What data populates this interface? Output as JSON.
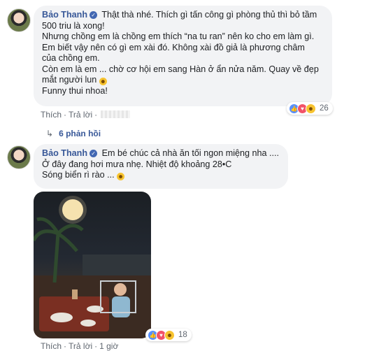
{
  "comments": [
    {
      "author": "Bảo Thanh",
      "lines": [
        "Thật thà nhé. Thích gì tấn công gì phòng thủ thì bỏ tầm",
        "500 triu là xong!",
        "Nhưng chồng em là chồng em thích “na tu ran” nên ko cho em làm gì.",
        "Em biết vậy nên có gì em xài đó. Không xài đồ giả là phương châm",
        "của chồng em.",
        "Còn em là em ... chờ cơ hội em sang Hàn ở ẩn nửa năm. Quay về đẹp",
        "mắt người lun",
        "Funny thui nhoa!"
      ],
      "actions": {
        "like": "Thích",
        "reply": "Trả lời"
      },
      "reactions": {
        "count": "26"
      },
      "replies_label": "6 phản hồi"
    },
    {
      "author": "Bảo Thanh",
      "lines": [
        "Em bé chúc cả nhà ăn tối ngon miệng nha ....",
        "Ở đây đang hơi mưa nhẹ. Nhiệt độ khoảng 28•C",
        "Sóng biển rì rào ..."
      ],
      "actions": {
        "like": "Thích",
        "reply": "Trả lời",
        "time": "1 giờ"
      },
      "reactions": {
        "count": "18"
      }
    }
  ],
  "colors": {
    "link": "#385898",
    "bubble": "#f2f3f5",
    "meta": "#606770"
  },
  "icons": {
    "verified": "verified-badge-icon",
    "laugh": "laughing-emoji-icon",
    "reply": "reply-arrow-icon"
  }
}
